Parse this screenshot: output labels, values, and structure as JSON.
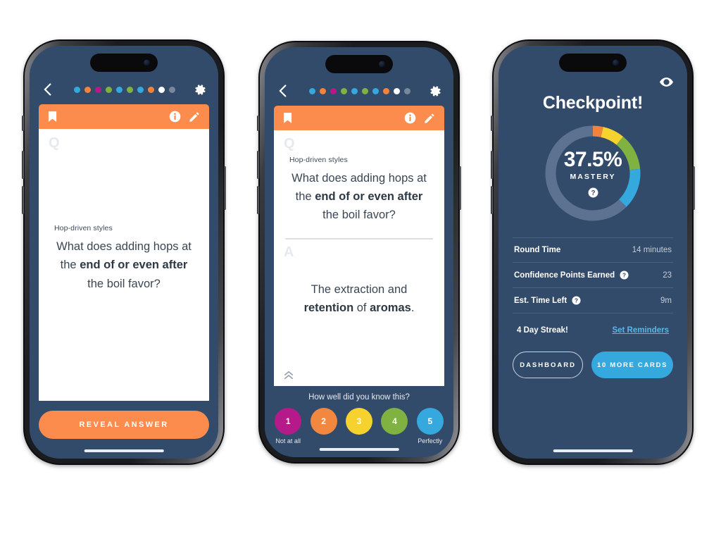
{
  "colors": {
    "navy": "#334B6B",
    "orange": "#FB8C4D",
    "blue": "#35A8DE",
    "green": "#7FB241",
    "yellow": "#F5D22E",
    "magenta": "#B51A8A",
    "white": "#FFFFFF",
    "gray": "#7A8798",
    "track": "#5D7291",
    "link_blue": "#5BB6E8"
  },
  "study": {
    "back_icon": "chevron-left-icon",
    "settings_icon": "gear-icon",
    "progress_dots": [
      {
        "color": "#35A8DE",
        "state": "blue"
      },
      {
        "color": "#F2833C",
        "state": "orange"
      },
      {
        "color": "#B51A8A",
        "state": "magenta"
      },
      {
        "color": "#7FB241",
        "state": "green"
      },
      {
        "color": "#35A8DE",
        "state": "blue"
      },
      {
        "color": "#7FB241",
        "state": "green"
      },
      {
        "color": "#35A8DE",
        "state": "blue"
      },
      {
        "color": "#F2833C",
        "state": "orange"
      },
      {
        "color": "#FFFFFF",
        "state": "current"
      },
      {
        "color": "#7A8798",
        "state": "upcoming"
      }
    ],
    "card_header": {
      "bookmark_icon": "bookmark-icon",
      "info_icon": "info-icon",
      "edit_icon": "pencil-icon"
    },
    "question_watermark": "Q",
    "answer_watermark": "A",
    "topic": "Hop-driven styles",
    "question_prefix": "What does adding hops at the ",
    "question_bold": "end of or even after",
    "question_suffix": " the boil favor?",
    "answer_prefix": "The extraction and ",
    "answer_bold1": "retention",
    "answer_mid": " of ",
    "answer_bold2": "aromas",
    "answer_suffix": ".",
    "collapse_icon": "double-chevron-up-icon",
    "reveal_label": "REVEAL ANSWER"
  },
  "rating": {
    "prompt": "How well did you know this?",
    "options": [
      {
        "value": "1",
        "color": "#B51A8A",
        "caption": "Not at all"
      },
      {
        "value": "2",
        "color": "#F2883F",
        "caption": ""
      },
      {
        "value": "3",
        "color": "#F5D22E",
        "caption": ""
      },
      {
        "value": "4",
        "color": "#7FB241",
        "caption": ""
      },
      {
        "value": "5",
        "color": "#35A8DE",
        "caption": "Perfectly"
      }
    ]
  },
  "checkpoint": {
    "visibility_icon": "eye-icon",
    "title": "Checkpoint!",
    "mastery_percent": "37.5%",
    "mastery_label": "MASTERY",
    "mastery_help_icon": "question-help-icon",
    "stats": [
      {
        "label": "Round Time",
        "value": "14 minutes",
        "has_help": false
      },
      {
        "label": "Confidence Points Earned",
        "value": "23",
        "has_help": true
      },
      {
        "label": "Est. Time Left",
        "value": "9m",
        "has_help": true
      }
    ],
    "streak": "4 Day Streak!",
    "reminders_link": "Set Reminders",
    "dashboard_label": "DASHBOARD",
    "more_cards_label": "10 MORE CARDS"
  },
  "chart_data": {
    "type": "pie",
    "title": "Mastery donut",
    "center_value": "37.5%",
    "center_label": "MASTERY",
    "segments": [
      {
        "name": "orange",
        "color": "#F2833C",
        "percent": 3.5
      },
      {
        "name": "yellow",
        "color": "#F5D22E",
        "percent": 7.5
      },
      {
        "name": "green",
        "color": "#7FB241",
        "percent": 12.5
      },
      {
        "name": "blue",
        "color": "#35A8DE",
        "percent": 14.0
      },
      {
        "name": "track",
        "color": "#5D7291",
        "percent": 62.5
      }
    ],
    "start_angle_deg": -90,
    "legend": "none",
    "grid": false
  }
}
